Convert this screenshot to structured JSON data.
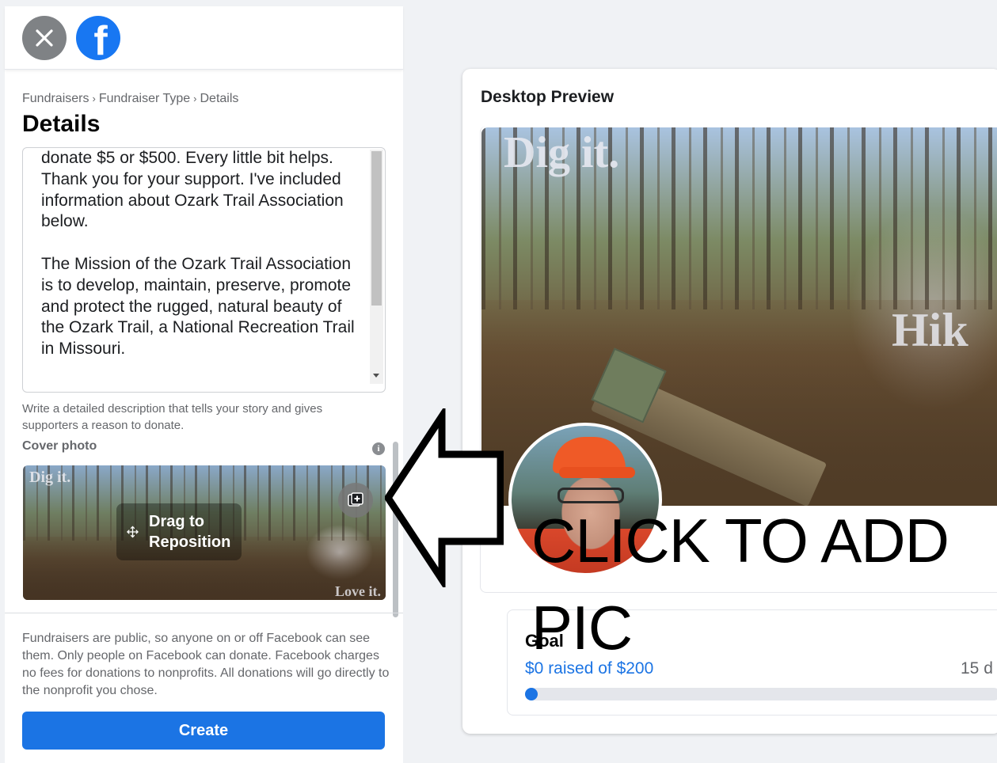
{
  "header": {
    "close_icon": "close-icon",
    "logo_icon": "facebook-logo-icon",
    "logo_glyph": "f"
  },
  "breadcrumb": {
    "items": [
      "Fundraisers",
      "Fundraiser Type",
      "Details"
    ],
    "separator": "›"
  },
  "page_title": "Details",
  "description": {
    "value": "donate $5 or $500. Every little bit helps. Thank you for your support. I've included information about Ozark Trail Association below.\n\nThe Mission of the Ozark Trail Association is to develop, maintain, preserve, promote and protect the rugged, natural beauty of the Ozark Trail, a National Recreation Trail in Missouri.",
    "help_text": "Write a detailed description that tells your story and gives supporters a reason to donate."
  },
  "cover_photo": {
    "label": "Cover photo",
    "info_icon": "i",
    "overlay_top_text": "Dig it.",
    "overlay_bottom_text": "Love it.",
    "drag_text": "Drag to Reposition"
  },
  "footer": {
    "notice": "Fundraisers are public, so anyone on or off Facebook can see them. Only people on Facebook can donate. Facebook charges no fees for donations to nonprofits. All donations will go directly to the nonprofit you chose.",
    "create_label": "Create"
  },
  "preview": {
    "title": "Desktop Preview",
    "cover_text_top": "Dig it.",
    "cover_text_right": "Hik",
    "overlay_annotation": "CLICK TO ADD PIC",
    "goal_label": "Goal",
    "goal_raised": "$0 raised of $200",
    "goal_days": "15 d",
    "goal_progress": 0
  },
  "colors": {
    "accent": "#1b74e4",
    "background": "#f0f2f5",
    "muted_text": "#65676b"
  }
}
